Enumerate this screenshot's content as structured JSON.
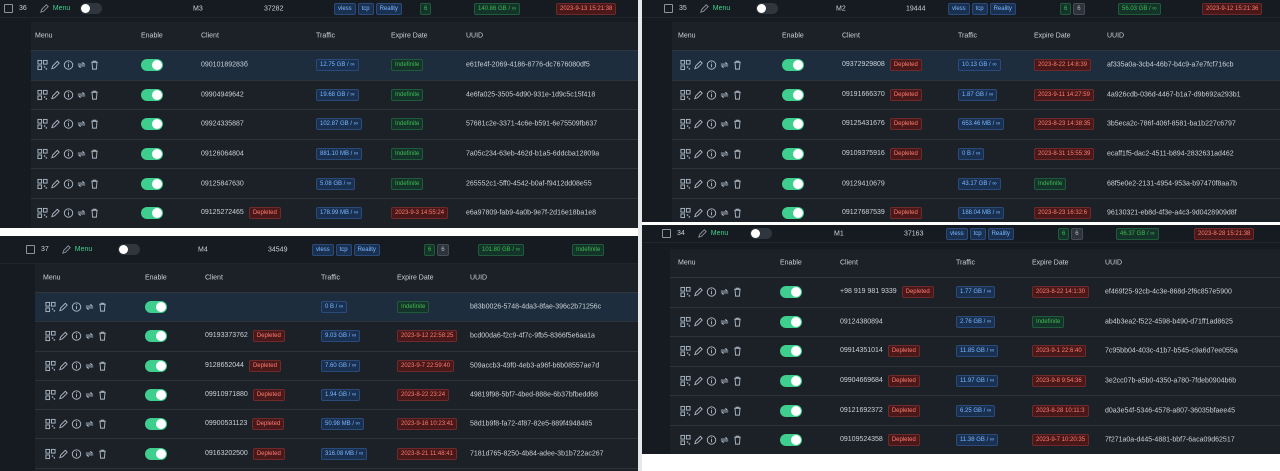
{
  "colors": {
    "accent": "#3ecf8e",
    "bg": "#161b22",
    "row": "#1c2128",
    "depleted": "#ff7b72",
    "indef": "#3fb950"
  },
  "icons": [
    "qrcode-icon",
    "edit-icon",
    "info-icon",
    "reset-icon",
    "delete-icon"
  ],
  "columns": {
    "menu": "Menu",
    "enable": "Enable",
    "client": "Client",
    "traffic": "Traffic",
    "expire": "Expire Date",
    "uuid": "UUID"
  },
  "inbounds": [
    {
      "id": "36",
      "menu": "Menu",
      "remark": "M3",
      "port": "37282",
      "protocol": "vless",
      "network": "tcp",
      "security": "Reality",
      "clients_a": "6",
      "clients_b": "",
      "traffic": "140.86 GB / ∞",
      "expiry": "2023-9-13 15:21:38",
      "expiry_style": "red",
      "clients": [
        {
          "client": "09010189283б",
          "depleted": "",
          "traffic": "12.75 GB / ∞",
          "expire": "Indefinite",
          "uuid": "e61fe4f-2069-4186-8776-dc7676080df5"
        },
        {
          "client": "09904949642",
          "depleted": "",
          "traffic": "19.68 GB / ∞",
          "expire": "Indefinite",
          "uuid": "4e6fa025-3505-4d90-931e-1d9c5c15f418"
        },
        {
          "client": "09924335887",
          "depleted": "",
          "traffic": "102.87 GB / ∞",
          "expire": "Indefinite",
          "uuid": "57681c2e-3371-4c6e-b591-6e75509fb637"
        },
        {
          "client": "09126064804",
          "depleted": "",
          "traffic": "881.10 MB / ∞",
          "expire": "Indefinite",
          "uuid": "7a05c234-63eb-462d-b1a5-6ddcba12809a"
        },
        {
          "client": "09125847630",
          "depleted": "",
          "traffic": "5.08 GB / ∞",
          "expire": "Indefinite",
          "uuid": "265552c1-5ff0-4542-b0af-f9412dd08e55"
        },
        {
          "client": "09125272465",
          "depleted": "Depleted",
          "traffic": "178.99 MB / ∞",
          "expire": "2023-9-3 14:55:24",
          "uuid": "e6a97809-fab9-4a0b-9e7f-2d16e18ba1e8"
        }
      ]
    },
    {
      "id": "37",
      "menu": "Menu",
      "remark": "M4",
      "port": "34549",
      "protocol": "vless",
      "network": "tcp",
      "security": "Reality",
      "clients_a": "6",
      "clients_b": "6",
      "traffic": "101.80 GB / ∞",
      "expiry": "Indefinite",
      "expiry_style": "green",
      "clients": [
        {
          "client": "",
          "depleted": "",
          "traffic": "0 B / ∞",
          "expire": "Indefinite",
          "uuid": "b83b0026-5748-4da3-8fae-396c2b71256c"
        },
        {
          "client": "09193373762",
          "depleted": "Depleted",
          "traffic": "9.03 GB / ∞",
          "expire": "2023-9-12 22:58:25",
          "uuid": "bcd00da6-f2c9-4f7c-9fb5-8366f5e6aa1a"
        },
        {
          "client": "9128652044",
          "depleted": "Depleted",
          "traffic": "7.60 GB / ∞",
          "expire": "2023-9-7 22:59:40",
          "uuid": "509accb3-49f0-4eb3-a96f-b6b08557ae7d"
        },
        {
          "client": "09910971880",
          "depleted": "Depleted",
          "traffic": "1.94 GB / ∞",
          "expire": "2023-8-22 23:24",
          "uuid": "49819f98-5bf7-4bed-888e-6b37bfbedd68"
        },
        {
          "client": "09900531123",
          "depleted": "Depleted",
          "traffic": "50.98 MB / ∞",
          "expire": "2023-9-16 10:23:41",
          "uuid": "58d1b9f8-fa72-4f87-82e5-889f4948485"
        },
        {
          "client": "09163202500",
          "depleted": "Depleted",
          "traffic": "316.08 MB / ∞",
          "expire": "2023-8-21 11:48:41",
          "uuid": "7181d765-8250-4b84-adee-3b1b722ac267"
        }
      ]
    },
    {
      "id": "35",
      "menu": "Menu",
      "remark": "M2",
      "port": "19444",
      "protocol": "vless",
      "network": "tcp",
      "security": "Reality",
      "clients_a": "6",
      "clients_b": "6",
      "traffic": "56.03 GB / ∞",
      "expiry": "2023-9-12 15:21:36",
      "expiry_style": "red",
      "clients": [
        {
          "client": "09372929808",
          "depleted": "Depleted",
          "traffic": "10.13 GB / ∞",
          "expire": "2023-8-22 14:8:39",
          "uuid": "af335a0a-3cb4-46b7-b4c9-a7e7fcf716cb"
        },
        {
          "client": "09191666370",
          "depleted": "Depleted",
          "traffic": "1.87 GB / ∞",
          "expire": "2023-9-11 14:27:59",
          "uuid": "4a926cdb-036d-4467-b1a7-d9b692a293b1"
        },
        {
          "client": "09125431676",
          "depleted": "Depleted",
          "traffic": "653.46 MB / ∞",
          "expire": "2023-8-23 14:38:35",
          "uuid": "3b5eca2c-786f-406f-8581-ba1b227c6797"
        },
        {
          "client": "09109375916",
          "depleted": "Depleted",
          "traffic": "0 B / ∞",
          "expire": "2023-8-31 15:55:39",
          "uuid": "ecaff1f5-dac2-4511-b894-2832631ad462"
        },
        {
          "client": "09129410679",
          "depleted": "",
          "traffic": "43.17 GB / ∞",
          "expire": "Indefinite",
          "uuid": "68f5e0e2-2131-4954-953a-b97470f8aa7b"
        },
        {
          "client": "09127687539",
          "depleted": "Depleted",
          "traffic": "188.04 MB / ∞",
          "expire": "2023-8-23 16:32:6",
          "uuid": "96130321-eb8d-4f3e-a4c3-9d0428909d8f"
        }
      ]
    },
    {
      "id": "34",
      "menu": "Menu",
      "remark": "M1",
      "port": "37163",
      "protocol": "vless",
      "network": "tcp",
      "security": "Reality",
      "clients_a": "6",
      "clients_b": "6",
      "traffic": "46.37 GB / ∞",
      "expiry": "2023-8-28 15:21:38",
      "expiry_style": "red",
      "clients": [
        {
          "client": "+98 919 981 9339",
          "depleted": "Depleted",
          "traffic": "1.77 GB / ∞",
          "expire": "2023-8-22 14:1:30",
          "uuid": "ef469f25-92cb-4c3e-868d-2f6c857e5900"
        },
        {
          "client": "09124380894",
          "depleted": "",
          "traffic": "2.76 GB / ∞",
          "expire": "Indefinite",
          "uuid": "ab4b3ea2-f522-4598-b490-d71ff1ad8625"
        },
        {
          "client": "09914351014",
          "depleted": "Depleted",
          "traffic": "11.85 GB / ∞",
          "expire": "2023-9-1 22:6:40",
          "uuid": "7c95bb04-403c-41b7-b545-c9a6d7ee055a"
        },
        {
          "client": "09904669684",
          "depleted": "Depleted",
          "traffic": "11.97 GB / ∞",
          "expire": "2023-9-8 9:54:36",
          "uuid": "3e2cc07b-a5b0-4350-a780-7fdeb0904b6b"
        },
        {
          "client": "09121692372",
          "depleted": "Depleted",
          "traffic": "6.25 GB / ∞",
          "expire": "2023-8-28 10:11:3",
          "uuid": "d0a3e54f-5346-4578-a807-36035bfaee45"
        },
        {
          "client": "09109524358",
          "depleted": "Depleted",
          "traffic": "11.38 GB / ∞",
          "expire": "2023-9-7 10:20:35",
          "uuid": "7f271a0a-d445-4881-bbf7-6aca09d62517"
        }
      ]
    }
  ]
}
